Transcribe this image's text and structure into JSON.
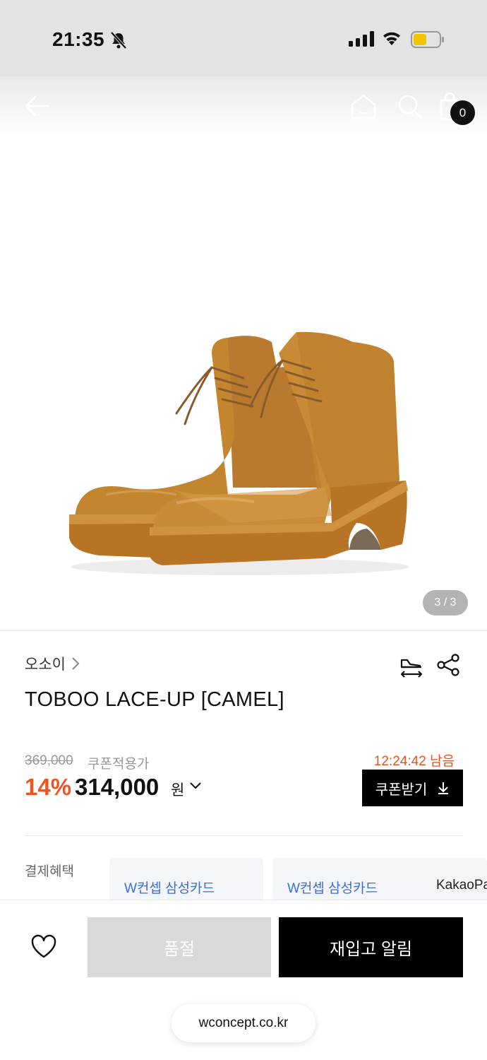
{
  "status_bar": {
    "time": "21:35",
    "battery_color": "#f5c400"
  },
  "nav": {
    "back_icon": "arrow-left-icon",
    "home_icon": "home-icon",
    "search_icon": "search-icon",
    "cart_icon": "shopping-bag-icon",
    "cart_count": "0"
  },
  "gallery": {
    "counter": "3 / 3",
    "current": 3,
    "total": 3
  },
  "product": {
    "brand": "오소이",
    "title": "TOBOO LACE-UP [CAMEL]",
    "original_price": "369,000",
    "coupon_price_label": "쿠폰적용가",
    "discount_rate": "14%",
    "sale_price": "314,000",
    "currency": "원",
    "timer": "12:24:42 남음",
    "coupon_button": "쿠폰받기"
  },
  "benefits": {
    "label": "결제혜택",
    "cards": [
      "W컨셉 삼성카드",
      "W컨셉 삼성카드",
      "KakaoPay"
    ]
  },
  "bottom": {
    "soldout_label": "품절",
    "restock_label": "재입고 알림"
  },
  "browser": {
    "url": "wconcept.co.kr"
  },
  "colors": {
    "discount": "#f0541e",
    "benefit_link": "#3a6fd8",
    "primary_button": "#000000",
    "disabled_button": "#d9d9d9"
  }
}
